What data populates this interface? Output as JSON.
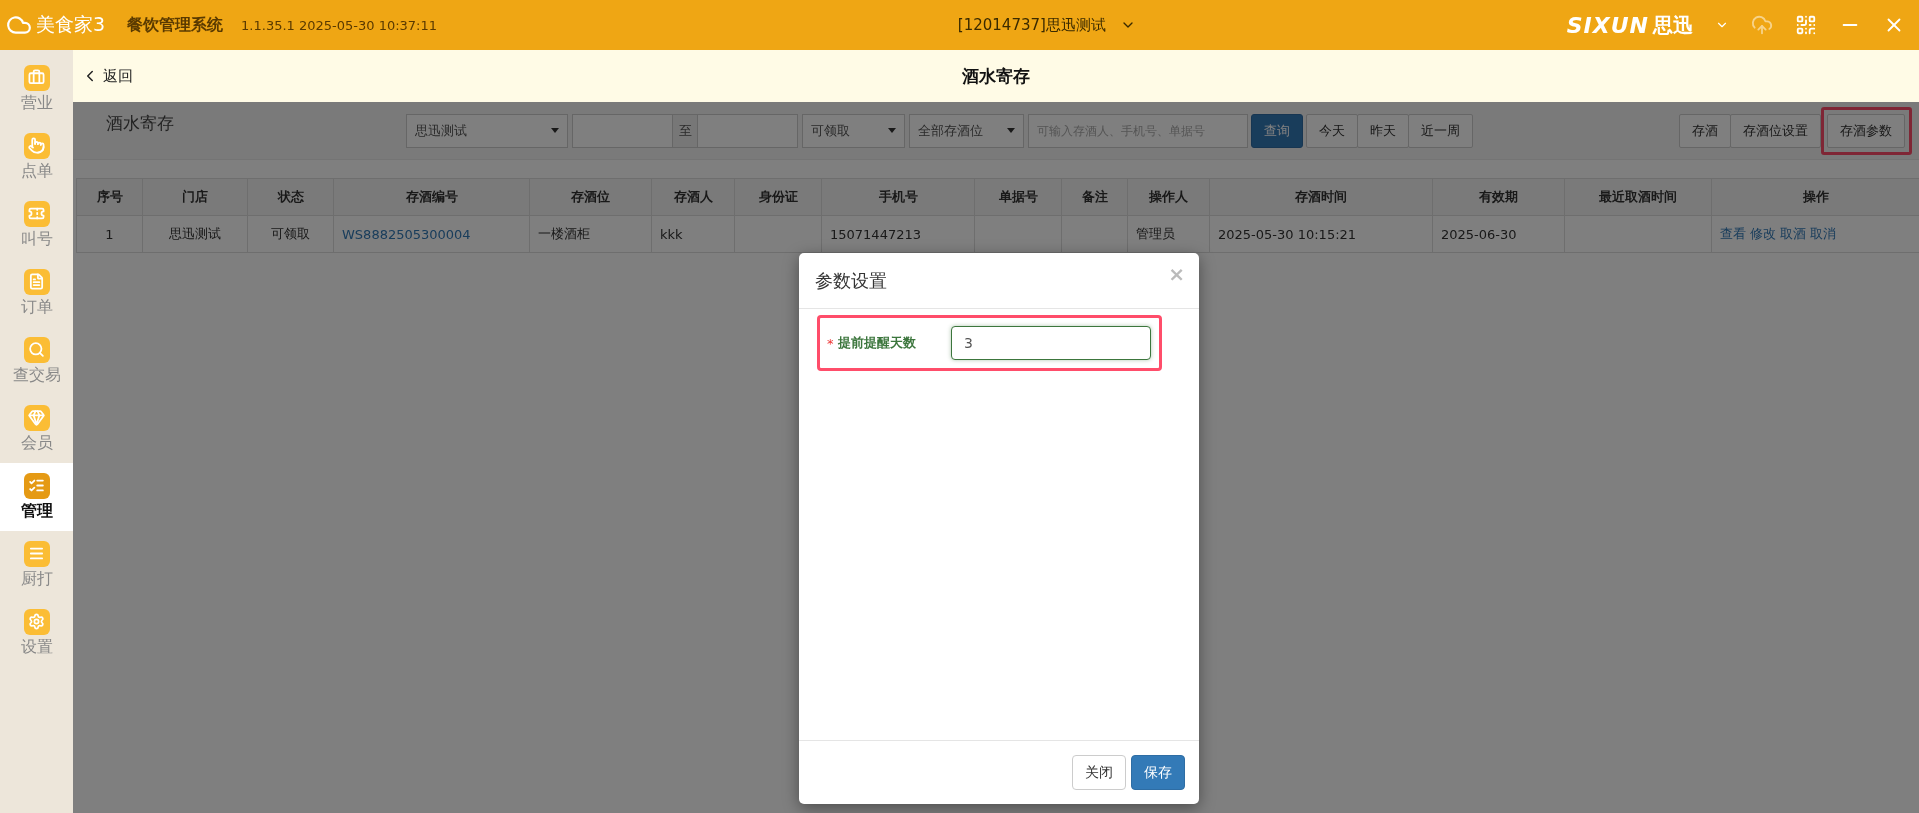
{
  "titlebar": {
    "app_name": "美食家3",
    "system": "餐饮管理系统",
    "version": "1.1.35.1 2025-05-30 10:37:11",
    "store": "[12014737]思迅测试",
    "brand": "SIXUN",
    "brand_cn": "思迅"
  },
  "sidebar": {
    "items": [
      {
        "label": "营业",
        "selected": false
      },
      {
        "label": "点单",
        "selected": false
      },
      {
        "label": "叫号",
        "selected": false
      },
      {
        "label": "订单",
        "selected": false
      },
      {
        "label": "查交易",
        "selected": false
      },
      {
        "label": "会员",
        "selected": false
      },
      {
        "label": "管理",
        "selected": true
      },
      {
        "label": "厨打",
        "selected": false
      },
      {
        "label": "设置",
        "selected": false
      }
    ]
  },
  "subheader": {
    "back": "返回",
    "title": "酒水寄存"
  },
  "toolbar": {
    "title": "酒水寄存",
    "store_select": "思迅测试",
    "date_to_label": "至",
    "status_select": "可领取",
    "location_select": "全部存酒位",
    "search_placeholder": "可输入存酒人、手机号、单据号",
    "query": "查询",
    "ranges": [
      "今天",
      "昨天",
      "近一周"
    ],
    "actions": [
      {
        "label": "存酒",
        "highlighted": false
      },
      {
        "label": "存酒位设置",
        "highlighted": false
      },
      {
        "label": "存酒参数",
        "highlighted": true
      }
    ]
  },
  "table": {
    "columns": [
      "序号",
      "门店",
      "状态",
      "存酒编号",
      "存酒位",
      "存酒人",
      "身份证",
      "手机号",
      "单据号",
      "备注",
      "操作人",
      "存酒时间",
      "有效期",
      "最近取酒时间",
      "操作"
    ],
    "rows": [
      {
        "cells": [
          "1",
          "思迅测试",
          "可领取",
          "WS8882505300004",
          "一楼酒柜",
          "kkk",
          "",
          "15071447213",
          "",
          "",
          "管理员",
          "2025-05-30 10:15:21",
          "2025-06-30",
          ""
        ],
        "actions": [
          "查看",
          "修改",
          "取酒",
          "取消"
        ]
      }
    ]
  },
  "dialog": {
    "title": "参数设置",
    "close": "×",
    "field": {
      "label": "提前提醒天数",
      "required_mark": "*",
      "value": "3",
      "highlighted": true
    },
    "buttons": [
      {
        "label": "关闭",
        "kind": "default"
      },
      {
        "label": "保存",
        "kind": "primary"
      }
    ]
  }
}
